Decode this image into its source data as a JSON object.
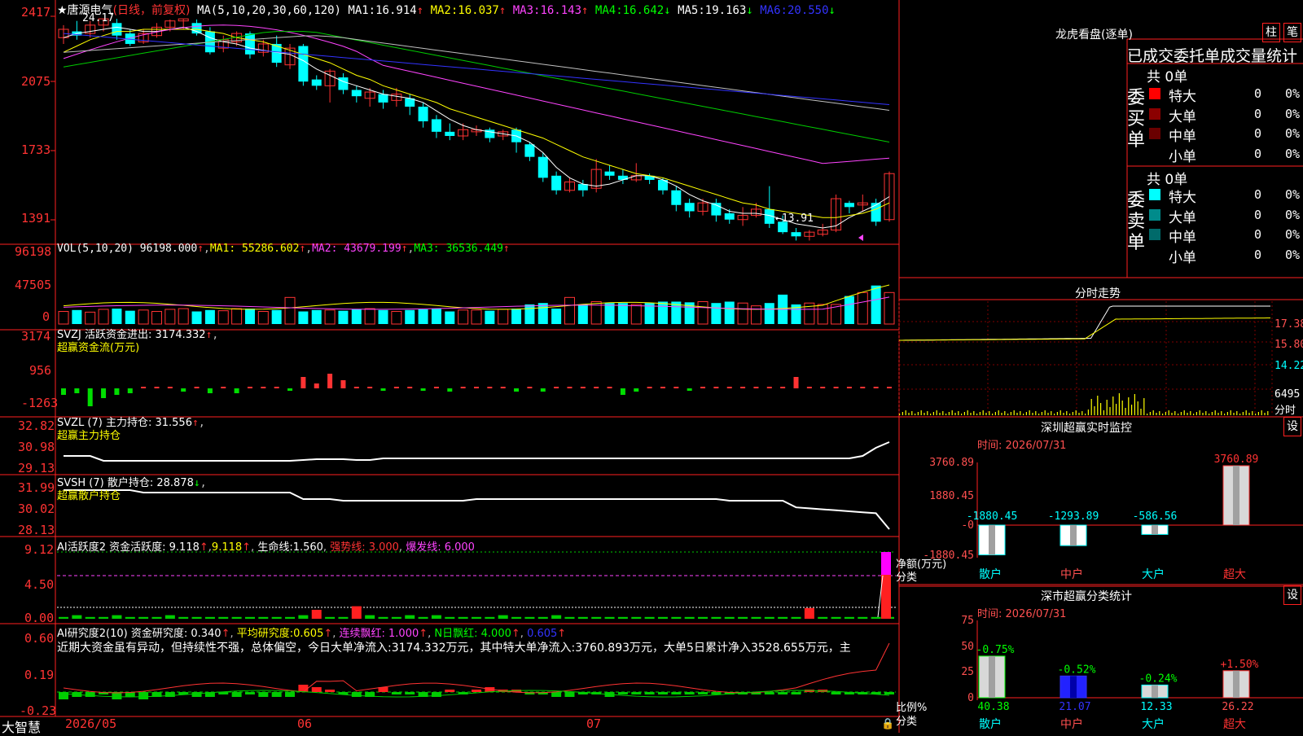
{
  "colors": {
    "up": "#ff3333",
    "down": "#00ffff",
    "ma1": "#ffffff",
    "ma2": "#ffff00",
    "ma3": "#ff44ff",
    "ma4": "#00cc00",
    "ma5": "#c0c0c0",
    "ma6": "#3333ff",
    "frame": "#ff2020",
    "bg": "#000000"
  },
  "header": {
    "title": "★唐源电气",
    "mode": "(日线，前复权)",
    "ma_def": "MA(5,10,20,30,60,120)",
    "ma": [
      {
        "label": "MA1:",
        "value": "16.914",
        "arrow": "↑"
      },
      {
        "label": "MA2:",
        "value": "16.037",
        "arrow": "↑"
      },
      {
        "label": "MA3:",
        "value": "16.143",
        "arrow": "↑"
      },
      {
        "label": "MA4:",
        "value": "16.642",
        "arrow": "↓"
      },
      {
        "label": "MA5:",
        "value": "19.163",
        "arrow": "↓"
      },
      {
        "label": "MA6:",
        "value": "20.550",
        "arrow": "↓"
      }
    ]
  },
  "price_axis": [
    "2417",
    "2075",
    "1733",
    "1391"
  ],
  "price_marks": {
    "high": "24.17",
    "low": "←13.91"
  },
  "vol_panel": {
    "def": "VOL(5,10,20)",
    "value": "96198.000",
    "ma1": "MA1: 55286.602",
    "ma2": "MA2: 43679.199",
    "ma3": "MA3: 36536.449",
    "axis": [
      "96198",
      "47505",
      "0"
    ]
  },
  "svzj_panel": {
    "line1": "SVZJ  活跃资金进出: 3174.332",
    "line2": "超赢资金流(万元)",
    "axis": [
      "3174",
      "956",
      "-1263"
    ]
  },
  "svzl_panel": {
    "line1": "SVZL (7) 主力持仓: 31.556",
    "line2": "超赢主力持仓",
    "axis": [
      "32.82",
      "30.98",
      "29.13"
    ]
  },
  "svsh_panel": {
    "line1": "SVSH (7) 散户持仓: 28.878",
    "line2": "超赢散户持仓",
    "axis": [
      "31.99",
      "30.02",
      "28.13"
    ]
  },
  "ai_active_panel": {
    "title": "AI活跃度2 资金活跃度:",
    "v1": "9.118",
    "v2": "9.118",
    "life": "生命线:",
    "life_v": "1.560",
    "strong": "强势线: 3.000",
    "burst": "爆发线: 6.000",
    "axis": [
      "9.12",
      "4.50",
      "0.00"
    ]
  },
  "ai_research_panel": {
    "title": "AI研究度2(10) 资金研究度:",
    "v1": "0.340",
    "avg": "平均研究度:",
    "avg_v": "0.605",
    "lian": "连续飘红: 1.000",
    "n": "N日飘红: 4.000",
    "last": "0.605",
    "comment": "近期大资金虽有异动，但持续性不强，总体偏空，今日大单净流入:3174.332万元，其中特大单净流入:3760.893万元，大单5日累计净入3528.655万元，主",
    "axis": [
      "0.60",
      "0.19",
      "-0.23"
    ]
  },
  "footer": {
    "brand": "大智慧",
    "dates": [
      "2026/05",
      "06",
      "07"
    ]
  },
  "dragon": {
    "title": "龙虎看盘(逐单)",
    "btn_a": "柱",
    "btn_b": "笔",
    "subtitle": "已成交委托单成交量统计",
    "buy_label": "委买单",
    "sell_label": "委卖单",
    "buy_total": "共 0单",
    "sell_total": "共 0单",
    "buy_rows": [
      {
        "name": "特大",
        "v": "0",
        "p": "0%",
        "c": "#ff0000"
      },
      {
        "name": "大单",
        "v": "0",
        "p": "0%",
        "c": "#8b0000"
      },
      {
        "name": "中单",
        "v": "0",
        "p": "0%",
        "c": "#6a0000"
      },
      {
        "name": "小单",
        "v": "0",
        "p": "0%",
        "c": "#000000"
      }
    ],
    "sell_rows": [
      {
        "name": "特大",
        "v": "0",
        "p": "0%",
        "c": "#00ffff"
      },
      {
        "name": "大单",
        "v": "0",
        "p": "0%",
        "c": "#008b8b"
      },
      {
        "name": "中单",
        "v": "0",
        "p": "0%",
        "c": "#006a6a"
      },
      {
        "name": "小单",
        "v": "0",
        "p": "0%",
        "c": "#000000"
      }
    ]
  },
  "intraday": {
    "title": "分时走势",
    "right_axis": [
      "17.38",
      "15.80",
      "14.22",
      "6495",
      "分时"
    ]
  },
  "sz_monitor": {
    "title": "深圳超赢实时监控",
    "btn": "设",
    "time_label": "时间: 2026/07/31",
    "y_axis": [
      "3760.89",
      "1880.45",
      "-0",
      "-1880.45"
    ],
    "ylabel": "净额(万元)",
    "xlabel": "分类",
    "categories": [
      "散户",
      "中户",
      "大户",
      "超大"
    ],
    "values": [
      -1880.45,
      -1293.89,
      -586.56,
      3760.89
    ],
    "labels": [
      "-1880.45",
      "-1293.89",
      "-586.56",
      "3760.89"
    ]
  },
  "sz_class": {
    "title": "深市超赢分类统计",
    "btn": "设",
    "time_label": "时间: 2026/07/31",
    "y_axis": [
      "75",
      "50",
      "25",
      "0"
    ],
    "ylabel": "比例%",
    "xlabel": "分类",
    "categories": [
      "散户",
      "中户",
      "大户",
      "超大"
    ],
    "pct": [
      "-0.75%",
      "-0.52%",
      "-0.24%",
      "+1.50%"
    ],
    "values": [
      40.38,
      21.07,
      12.33,
      26.22
    ],
    "labels": [
      "40.38",
      "21.07",
      "12.33",
      "26.22"
    ]
  },
  "chart_data": {
    "type": "candlestick",
    "title": "唐源电气 日线",
    "ylim": [
      13.5,
      24.4
    ],
    "candles": [
      [
        23.3,
        23.7,
        23.9,
        23.0
      ],
      [
        23.6,
        23.4,
        24.1,
        23.2
      ],
      [
        23.5,
        23.9,
        24.1,
        23.3
      ],
      [
        23.9,
        24.2,
        24.2,
        23.6
      ],
      [
        24.0,
        23.4,
        24.2,
        23.2
      ],
      [
        23.5,
        23.0,
        23.7,
        22.9
      ],
      [
        23.1,
        23.5,
        23.7,
        23.0
      ],
      [
        23.4,
        23.8,
        24.0,
        23.3
      ],
      [
        23.8,
        24.1,
        24.17,
        23.6
      ],
      [
        24.1,
        24.2,
        24.2,
        23.7
      ],
      [
        24.0,
        23.5,
        24.17,
        23.4
      ],
      [
        23.6,
        22.6,
        23.8,
        22.5
      ],
      [
        22.8,
        23.2,
        23.4,
        22.6
      ],
      [
        23.1,
        23.5,
        23.6,
        22.9
      ],
      [
        23.5,
        22.5,
        23.6,
        22.3
      ],
      [
        22.6,
        23.0,
        23.2,
        22.4
      ],
      [
        23.0,
        22.1,
        23.4,
        21.9
      ],
      [
        22.0,
        22.8,
        23.0,
        21.8
      ],
      [
        22.9,
        21.2,
        23.0,
        21.0
      ],
      [
        21.3,
        21.0,
        21.5,
        20.8
      ],
      [
        21.0,
        21.7,
        21.8,
        20.2
      ],
      [
        21.4,
        20.8,
        21.6,
        20.6
      ],
      [
        20.8,
        20.5,
        21.0,
        20.2
      ],
      [
        20.4,
        20.7,
        20.9,
        20.0
      ],
      [
        20.6,
        20.2,
        20.8,
        19.9
      ],
      [
        20.3,
        20.6,
        20.9,
        20.0
      ],
      [
        20.4,
        20.0,
        20.6,
        19.6
      ],
      [
        20.0,
        19.3,
        20.2,
        19.0
      ],
      [
        19.4,
        18.8,
        19.6,
        18.5
      ],
      [
        18.8,
        18.6,
        19.2,
        18.4
      ],
      [
        18.6,
        18.9,
        19.2,
        18.4
      ],
      [
        18.8,
        18.9,
        19.1,
        18.6
      ],
      [
        18.9,
        18.5,
        19.0,
        18.3
      ],
      [
        18.6,
        18.8,
        18.9,
        18.4
      ],
      [
        18.9,
        18.3,
        19.0,
        17.8
      ],
      [
        18.2,
        17.6,
        18.3,
        17.4
      ],
      [
        17.6,
        16.6,
        17.8,
        16.4
      ],
      [
        16.7,
        16.0,
        16.9,
        15.8
      ],
      [
        16.0,
        16.4,
        16.6,
        15.9
      ],
      [
        16.3,
        16.0,
        16.5,
        15.7
      ],
      [
        16.1,
        17.0,
        17.5,
        15.9
      ],
      [
        16.9,
        16.7,
        17.2,
        16.5
      ],
      [
        16.7,
        16.5,
        17.0,
        16.3
      ],
      [
        16.5,
        16.7,
        17.3,
        16.4
      ],
      [
        16.7,
        16.5,
        16.8,
        16.3
      ],
      [
        16.5,
        16.0,
        16.6,
        15.8
      ],
      [
        16.0,
        15.3,
        16.2,
        15.0
      ],
      [
        15.4,
        15.0,
        15.6,
        14.7
      ],
      [
        15.0,
        15.4,
        15.6,
        14.8
      ],
      [
        15.4,
        14.8,
        15.6,
        14.5
      ],
      [
        14.9,
        14.6,
        15.1,
        14.4
      ],
      [
        14.6,
        14.8,
        15.2,
        14.3
      ],
      [
        14.8,
        15.1,
        15.4,
        14.7
      ],
      [
        15.1,
        14.4,
        16.2,
        14.2
      ],
      [
        14.5,
        14.0,
        14.8,
        13.91
      ],
      [
        14.0,
        13.8,
        14.2,
        13.6
      ],
      [
        13.8,
        14.0,
        14.1,
        13.6
      ],
      [
        13.9,
        14.1,
        14.4,
        13.8
      ],
      [
        14.1,
        15.6,
        15.8,
        14.0
      ],
      [
        15.4,
        15.2,
        15.5,
        14.9
      ],
      [
        15.3,
        15.4,
        15.8,
        15.0
      ],
      [
        15.4,
        14.5,
        15.6,
        14.3
      ],
      [
        14.6,
        16.8,
        16.9,
        14.5
      ]
    ],
    "ma_series": {
      "ma1": [
        23.3,
        23.5,
        23.6,
        23.7,
        23.8,
        23.7,
        23.6,
        23.6,
        23.7,
        23.8,
        23.6,
        23.3,
        23.1,
        23.0,
        22.8,
        22.7,
        22.6,
        22.5,
        22.2,
        21.8,
        21.5,
        21.2,
        21.0,
        20.8,
        20.6,
        20.5,
        20.4,
        20.2,
        19.8,
        19.4,
        19.1,
        18.9,
        18.8,
        18.7,
        18.6,
        18.3,
        17.8,
        17.1,
        16.6,
        16.3,
        16.2,
        16.3,
        16.5,
        16.7,
        16.7,
        16.5,
        16.2,
        15.8,
        15.5,
        15.3,
        15.0,
        14.9,
        14.9,
        14.8,
        14.6,
        14.4,
        14.3,
        14.2,
        14.3,
        14.7,
        15.0,
        15.3,
        15.7
      ],
      "ma2": [
        22.6,
        22.9,
        23.2,
        23.4,
        23.6,
        23.6,
        23.7,
        23.7,
        23.7,
        23.7,
        23.7,
        23.6,
        23.5,
        23.3,
        23.2,
        23.1,
        22.9,
        22.7,
        22.5,
        22.3,
        22.1,
        21.8,
        21.5,
        21.3,
        21.0,
        20.8,
        20.6,
        20.4,
        20.2,
        19.9,
        19.7,
        19.5,
        19.3,
        19.1,
        18.9,
        18.7,
        18.5,
        18.2,
        17.9,
        17.6,
        17.4,
        17.2,
        17.0,
        16.8,
        16.7,
        16.6,
        16.4,
        16.2,
        16.0,
        15.8,
        15.6,
        15.4,
        15.3,
        15.1,
        15.0,
        14.9,
        14.8,
        14.7,
        14.7,
        14.8,
        14.9,
        15.1,
        15.4
      ]
    }
  }
}
